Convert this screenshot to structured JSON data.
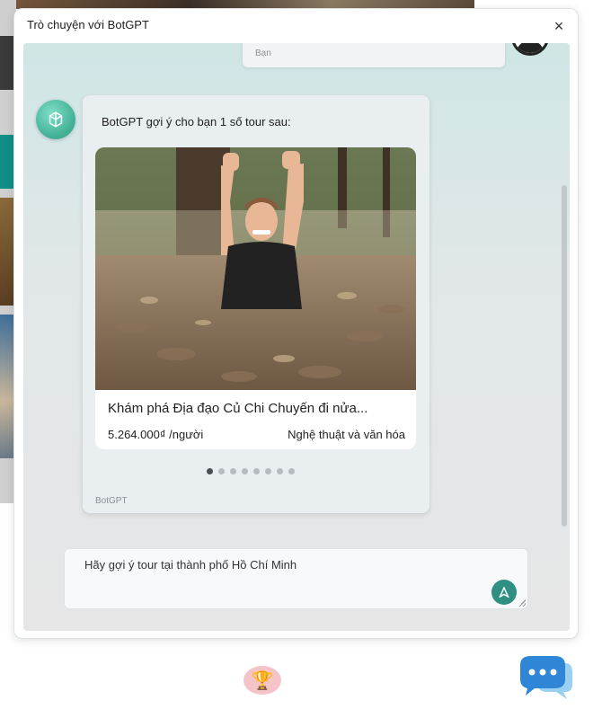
{
  "chat": {
    "title": "Trò chuyện với BotGPT",
    "close_label": "×",
    "user_message": {
      "sender": "Bạn"
    },
    "bot_message": {
      "intro": "BotGPT gợi ý cho bạn 1 số tour sau:",
      "sender": "BotGPT",
      "tour": {
        "name": "Khám phá Địa đạo Củ Chi Chuyến đi nửa...",
        "price": "5.264.000₫ /người",
        "category": "Nghệ thuật và văn hóa"
      },
      "carousel": {
        "total": 8,
        "active_index": 0
      }
    },
    "input": {
      "value": "Hãy gợi ý tour tại thành phố Hồ Chí Minh"
    }
  },
  "icons": {
    "close": "close-icon",
    "bot_avatar": "openai-logo-icon",
    "user_avatar": "user-icon",
    "send": "send-icon",
    "launcher": "chat-bubble-icon",
    "trophy": "trophy-icon"
  },
  "colors": {
    "accent": "#2f8f83",
    "launcher": "#2f86d6"
  }
}
